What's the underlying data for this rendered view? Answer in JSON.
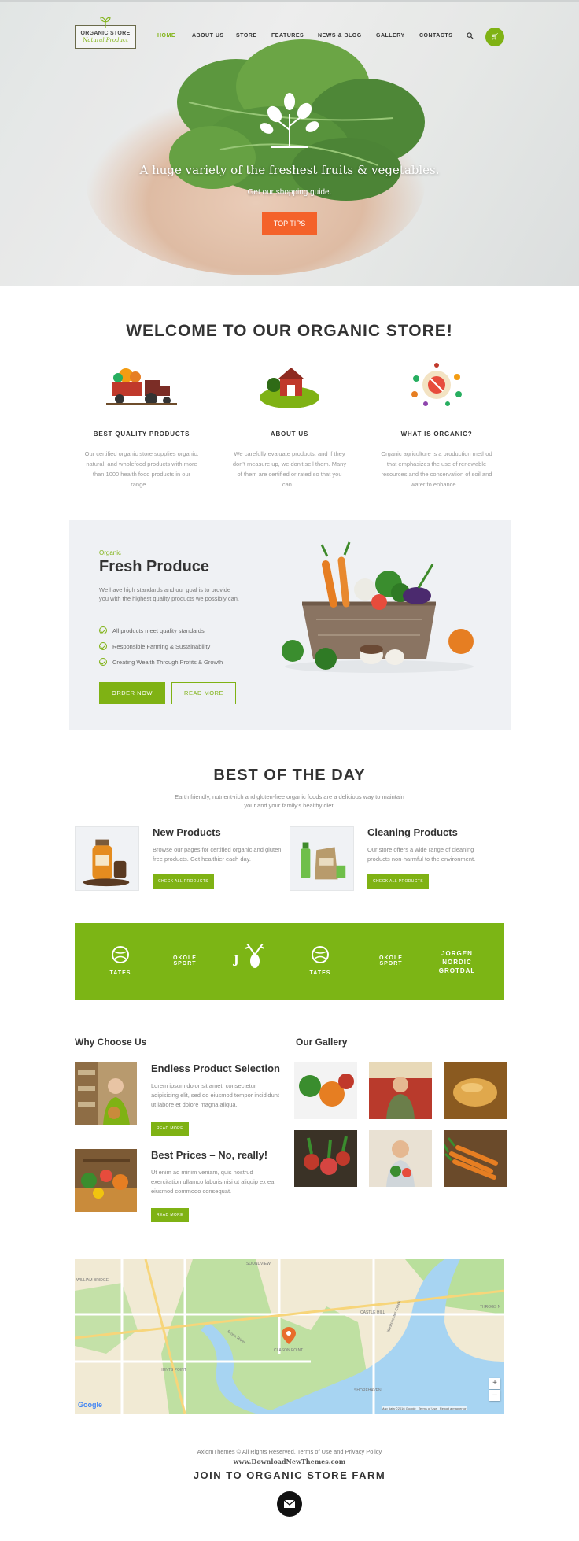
{
  "header": {
    "logo_title": "ORGANIC STORE",
    "logo_subtitle": "Natural Product",
    "nav": [
      "HOME",
      "ABOUT US",
      "STORE",
      "FEATURES",
      "NEWS & BLOG",
      "GALLERY",
      "CONTACTS"
    ],
    "active_nav": "HOME",
    "cart_count": "0"
  },
  "hero": {
    "title": "A huge variety of the freshest fruits & vegetables.",
    "subtitle": "Get our shopping guide.",
    "button": "TOP TIPS"
  },
  "welcome": {
    "title": "WELCOME TO OUR ORGANIC STORE!",
    "features": [
      {
        "title": "BEST QUALITY PRODUCTS",
        "text": "Our certified organic store supplies organic, natural, and wholefood products with more than 1000 health food products in our range...."
      },
      {
        "title": "ABOUT US",
        "text": "We carefully evaluate products, and if they don't measure up, we don't sell them. Many of them are certified or rated so that you can..."
      },
      {
        "title": "WHAT IS ORGANIC?",
        "text": "Organic agriculture is a production method that emphasizes the use of renewable resources and the conservation of soil and water to enhance...."
      }
    ]
  },
  "fresh": {
    "kicker": "Organic",
    "title": "Fresh Produce",
    "description": "We have high standards and our goal is to provide you with the highest quality products we possibly can.",
    "list": [
      "All products meet quality standards",
      "Responsible Farming & Sustainability",
      "Creating Wealth Through Profits & Growth"
    ],
    "order_button": "ORDER NOW",
    "read_button": "READ MORE"
  },
  "best": {
    "title": "BEST OF THE DAY",
    "description": "Earth friendly, nutrient-rich and gluten-free organic foods are a delicious way to maintain your and your family's healthy diet.",
    "products": [
      {
        "title": "New Products",
        "text": "Browse our pages for certified organic and gluten free products. Get healthier each day.",
        "button": "CHECK ALL PRODUCTS"
      },
      {
        "title": "Cleaning Products",
        "text": "Our store offers a wide range of cleaning products non-harmful to the environment.",
        "button": "CHECK ALL PRODUCTS"
      }
    ]
  },
  "brands": [
    "TATES",
    "OKOLE SPORT",
    "J",
    "TATES",
    "OKOLE SPORT",
    "JORGEN NORDIC GROTDAL"
  ],
  "why": {
    "title": "Why Choose Us",
    "items": [
      {
        "title": "Endless Product Selection",
        "text": "Lorem ipsum dolor sit amet, consectetur adipisicing elit, sed do eiusmod tempor incididunt ut labore et dolore magna aliqua.",
        "button": "READ MORE"
      },
      {
        "title": "Best Prices – No, really!",
        "text": "Ut enim ad minim veniam, quis nostrud exercitation ullamco laboris nisi ut aliquip ex ea eiusmod commodo consequat.",
        "button": "READ MORE"
      }
    ]
  },
  "gallery": {
    "title": "Our Gallery"
  },
  "map": {
    "labels": [
      "SOUNDVIEW",
      "CASTLE HILL",
      "CLASON POINT",
      "HUNTS POINT",
      "SHOREHAVEN",
      "THROGS N",
      "WILLIAM BRIDGE",
      "Bronx River",
      "Westchester Creek"
    ],
    "attribution": [
      "Map data ©2016 Google",
      "Terms of Use",
      "Report a map error"
    ],
    "google": "Google",
    "zoom_in": "+",
    "zoom_out": "–"
  },
  "footer": {
    "copyright": "AxiomThemes © All Rights Reserved. Terms of Use and Privacy Policy",
    "site": "www.DownloadNewThemes.com",
    "join": "JOIN TO ORGANIC STORE FARM"
  },
  "colors": {
    "accent": "#7fb214",
    "orange": "#f4622a",
    "brand_band": "#7cb515"
  }
}
